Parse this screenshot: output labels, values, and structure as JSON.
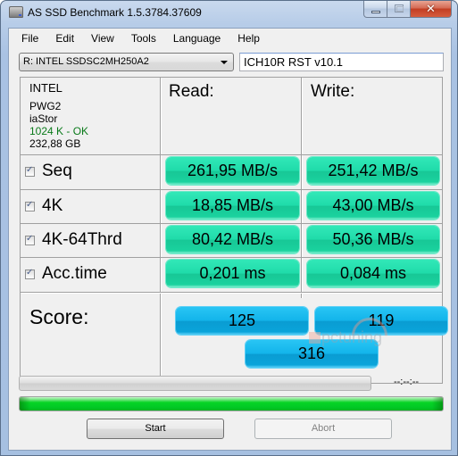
{
  "window": {
    "title": "AS SSD Benchmark 1.5.3784.37609",
    "icon": "drive-icon",
    "controls": {
      "minimize": "minimize-icon",
      "maximize": "maximize-icon",
      "close": "close-icon",
      "close_glyph": "✕"
    }
  },
  "menu": [
    "File",
    "Edit",
    "View",
    "Tools",
    "Language",
    "Help"
  ],
  "drive_select": {
    "value": "R: INTEL SSDSC2MH250A2"
  },
  "controller": {
    "value": "ICH10R RST v10.1"
  },
  "drive_info": {
    "brand": "INTEL",
    "firmware": "PWG2",
    "driver": "iaStor",
    "alignment": "1024 K - OK",
    "size": "232,88 GB",
    "alignment_color": "#0a7a1a"
  },
  "columns": {
    "read": "Read:",
    "write": "Write:"
  },
  "tests": [
    {
      "name": "Seq",
      "checked": true,
      "read": "261,95 MB/s",
      "write": "251,42 MB/s"
    },
    {
      "name": "4K",
      "checked": true,
      "read": "18,85 MB/s",
      "write": "43,00 MB/s"
    },
    {
      "name": "4K-64Thrd",
      "checked": true,
      "read": "80,42 MB/s",
      "write": "50,36 MB/s"
    },
    {
      "name": "Acc.time",
      "checked": true,
      "read": "0,201 ms",
      "write": "0,084 ms"
    }
  ],
  "score": {
    "label": "Score:",
    "read": "125",
    "write": "119",
    "total": "316"
  },
  "watermark": "pctuning",
  "progress": {
    "current_percent": 0,
    "total_percent": 100,
    "timer": "--:--:--"
  },
  "buttons": {
    "start": "Start",
    "abort": "Abort"
  },
  "colors": {
    "result_green": "#1fdba9",
    "score_blue": "#12b4ea",
    "progress_green": "#06d425"
  }
}
